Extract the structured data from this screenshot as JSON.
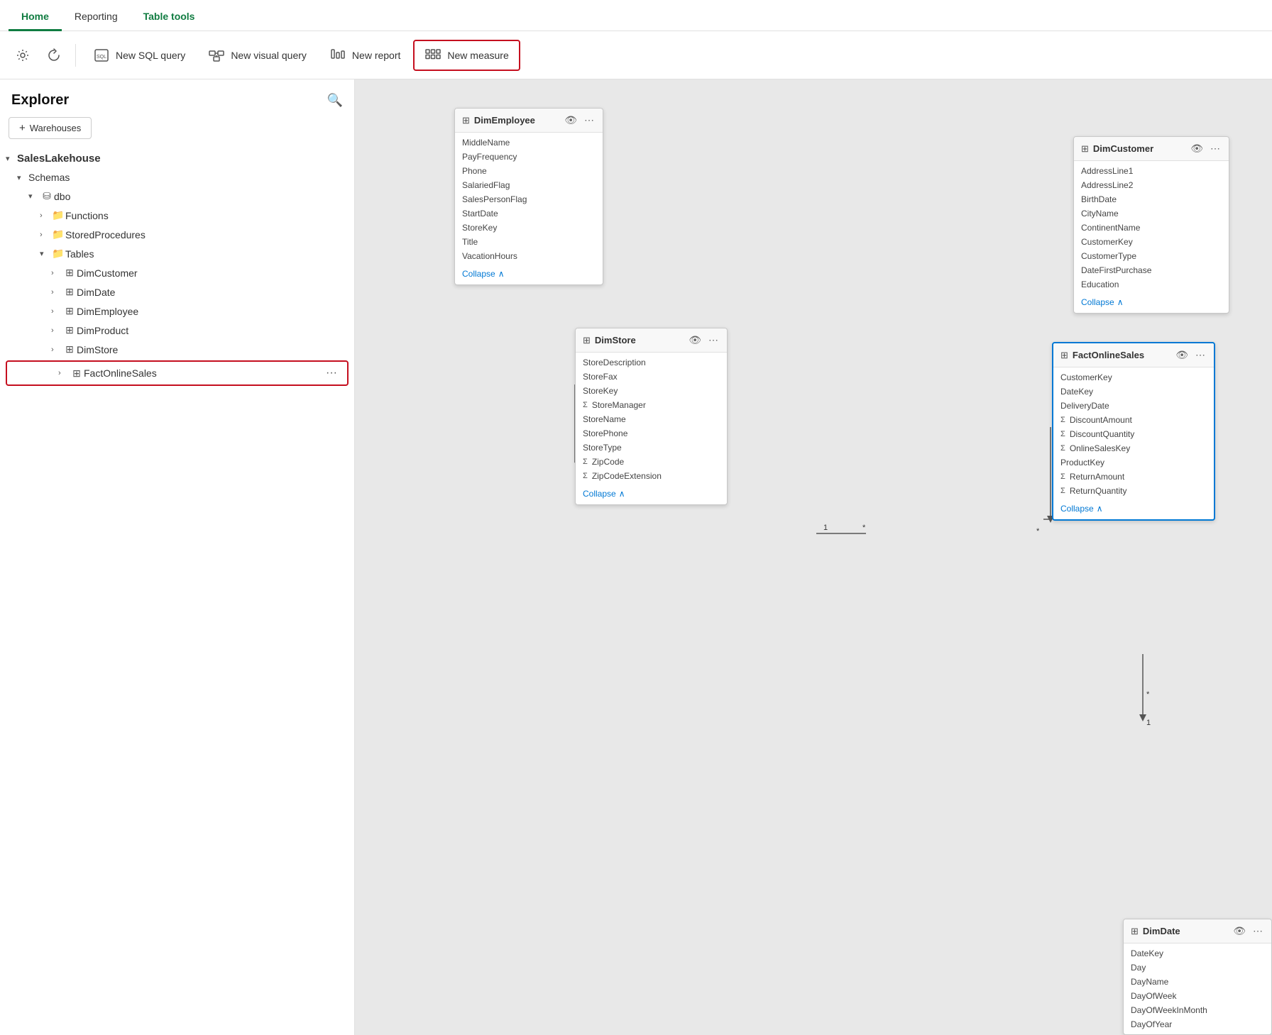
{
  "nav": {
    "tabs": [
      {
        "id": "home",
        "label": "Home",
        "active": true
      },
      {
        "id": "reporting",
        "label": "Reporting",
        "active": false
      },
      {
        "id": "table-tools",
        "label": "Table tools",
        "active": false
      }
    ]
  },
  "toolbar": {
    "settings_icon": "⚙",
    "refresh_icon": "↻",
    "new_sql_label": "New SQL query",
    "new_visual_label": "New visual query",
    "new_report_label": "New report",
    "new_measure_label": "New measure"
  },
  "sidebar": {
    "title": "Explorer",
    "add_label": "Warehouses",
    "tree": {
      "root": "SalesLakehouse",
      "schemas": "Schemas",
      "dbo": "dbo",
      "functions": "Functions",
      "stored_procedures": "StoredProcedures",
      "tables": "Tables",
      "tables_list": [
        "DimCustomer",
        "DimDate",
        "DimEmployee",
        "DimProduct",
        "DimStore",
        "FactOnlineSales"
      ]
    }
  },
  "diagram": {
    "cards": {
      "dim_employee": {
        "title": "DimEmployee",
        "fields": [
          {
            "name": "MiddleName",
            "sigma": false
          },
          {
            "name": "PayFrequency",
            "sigma": false
          },
          {
            "name": "Phone",
            "sigma": false
          },
          {
            "name": "SalariedFlag",
            "sigma": false
          },
          {
            "name": "SalesPersonFlag",
            "sigma": false
          },
          {
            "name": "StartDate",
            "sigma": false
          },
          {
            "name": "StoreKey",
            "sigma": false
          },
          {
            "name": "Title",
            "sigma": false
          },
          {
            "name": "VacationHours",
            "sigma": false
          }
        ],
        "collapse": "Collapse"
      },
      "dim_customer": {
        "title": "DimCustomer",
        "fields": [
          {
            "name": "AddressLine1",
            "sigma": false
          },
          {
            "name": "AddressLine2",
            "sigma": false
          },
          {
            "name": "BirthDate",
            "sigma": false
          },
          {
            "name": "CityName",
            "sigma": false
          },
          {
            "name": "ContinentName",
            "sigma": false
          },
          {
            "name": "CustomerKey",
            "sigma": false
          },
          {
            "name": "CustomerType",
            "sigma": false
          },
          {
            "name": "DateFirstPurchase",
            "sigma": false
          },
          {
            "name": "Education",
            "sigma": false
          }
        ],
        "collapse": "Collapse"
      },
      "dim_store": {
        "title": "DimStore",
        "fields": [
          {
            "name": "StoreDescription",
            "sigma": false
          },
          {
            "name": "StoreFax",
            "sigma": false
          },
          {
            "name": "StoreKey",
            "sigma": false
          },
          {
            "name": "StoreManager",
            "sigma": true
          },
          {
            "name": "StoreName",
            "sigma": false
          },
          {
            "name": "StorePhone",
            "sigma": false
          },
          {
            "name": "StoreType",
            "sigma": false
          },
          {
            "name": "ZipCode",
            "sigma": true
          },
          {
            "name": "ZipCodeExtension",
            "sigma": true
          }
        ],
        "collapse": "Collapse"
      },
      "fact_online_sales": {
        "title": "FactOnlineSales",
        "fields": [
          {
            "name": "CustomerKey",
            "sigma": false
          },
          {
            "name": "DateKey",
            "sigma": false
          },
          {
            "name": "DeliveryDate",
            "sigma": false
          },
          {
            "name": "DiscountAmount",
            "sigma": true
          },
          {
            "name": "DiscountQuantity",
            "sigma": true
          },
          {
            "name": "OnlineSalesKey",
            "sigma": true
          },
          {
            "name": "ProductKey",
            "sigma": false
          },
          {
            "name": "ReturnAmount",
            "sigma": true
          },
          {
            "name": "ReturnQuantity",
            "sigma": true
          }
        ],
        "collapse": "Collapse"
      },
      "dim_date": {
        "title": "DimDate",
        "fields": [
          {
            "name": "DateKey",
            "sigma": false
          },
          {
            "name": "Day",
            "sigma": false
          },
          {
            "name": "DayName",
            "sigma": false
          },
          {
            "name": "DayOfWeek",
            "sigma": false
          },
          {
            "name": "DayOfWeekInMonth",
            "sigma": false
          },
          {
            "name": "DayOfYear",
            "sigma": false
          }
        ],
        "collapse": "Collapse"
      }
    },
    "relation_labels": {
      "one": "1",
      "many": "*"
    }
  }
}
